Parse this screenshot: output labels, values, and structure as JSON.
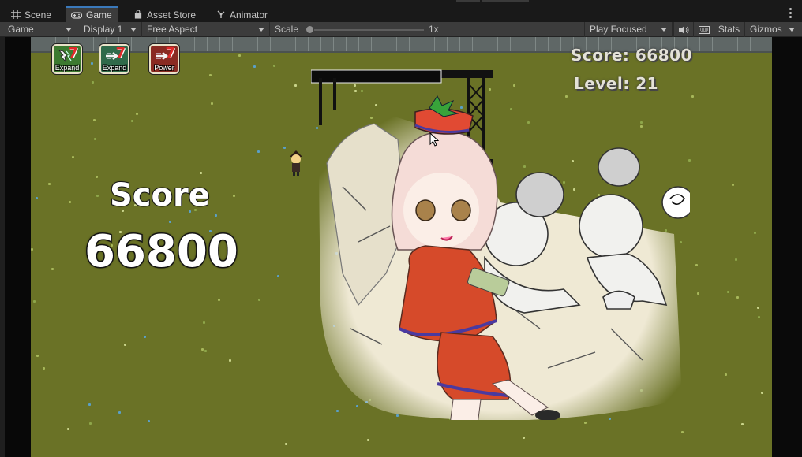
{
  "tabs": [
    {
      "label": "Scene",
      "icon": "grid-icon",
      "active": false
    },
    {
      "label": "Game",
      "icon": "gamepad-icon",
      "active": true
    },
    {
      "label": "Asset Store",
      "icon": "shopping-bag-icon",
      "active": false
    },
    {
      "label": "Animator",
      "icon": "animator-icon",
      "active": false
    }
  ],
  "toolbar": {
    "view_select": "Game",
    "display_select": "Display 1",
    "aspect_select": "Free Aspect",
    "scale_label": "Scale",
    "scale_value": "1x",
    "scale_fraction": 0.0,
    "play_mode_select": "Play Focused",
    "audio_icon": "speaker-icon",
    "stats_icon": "keyboard-icon",
    "stats_label": "Stats",
    "gizmos_label": "Gizmos"
  },
  "game": {
    "powerups": [
      {
        "label": "Expand",
        "icon": "lightning-icon",
        "number": "7",
        "bg": "#3c7a30"
      },
      {
        "label": "Expand",
        "icon": "arrow-icon",
        "number": "7",
        "bg": "#2f6a4a"
      },
      {
        "label": "Power",
        "icon": "arrow-icon",
        "number": "7",
        "bg": "#8a2a22"
      }
    ],
    "hud_score": "Score: 66800",
    "hud_level": "Level: 21",
    "big_score_label": "Score",
    "big_score_value": "66800"
  },
  "colors": {
    "grass": "#6a7226",
    "editor_bg": "#3c3c3c",
    "accent": "#3a79bb"
  }
}
